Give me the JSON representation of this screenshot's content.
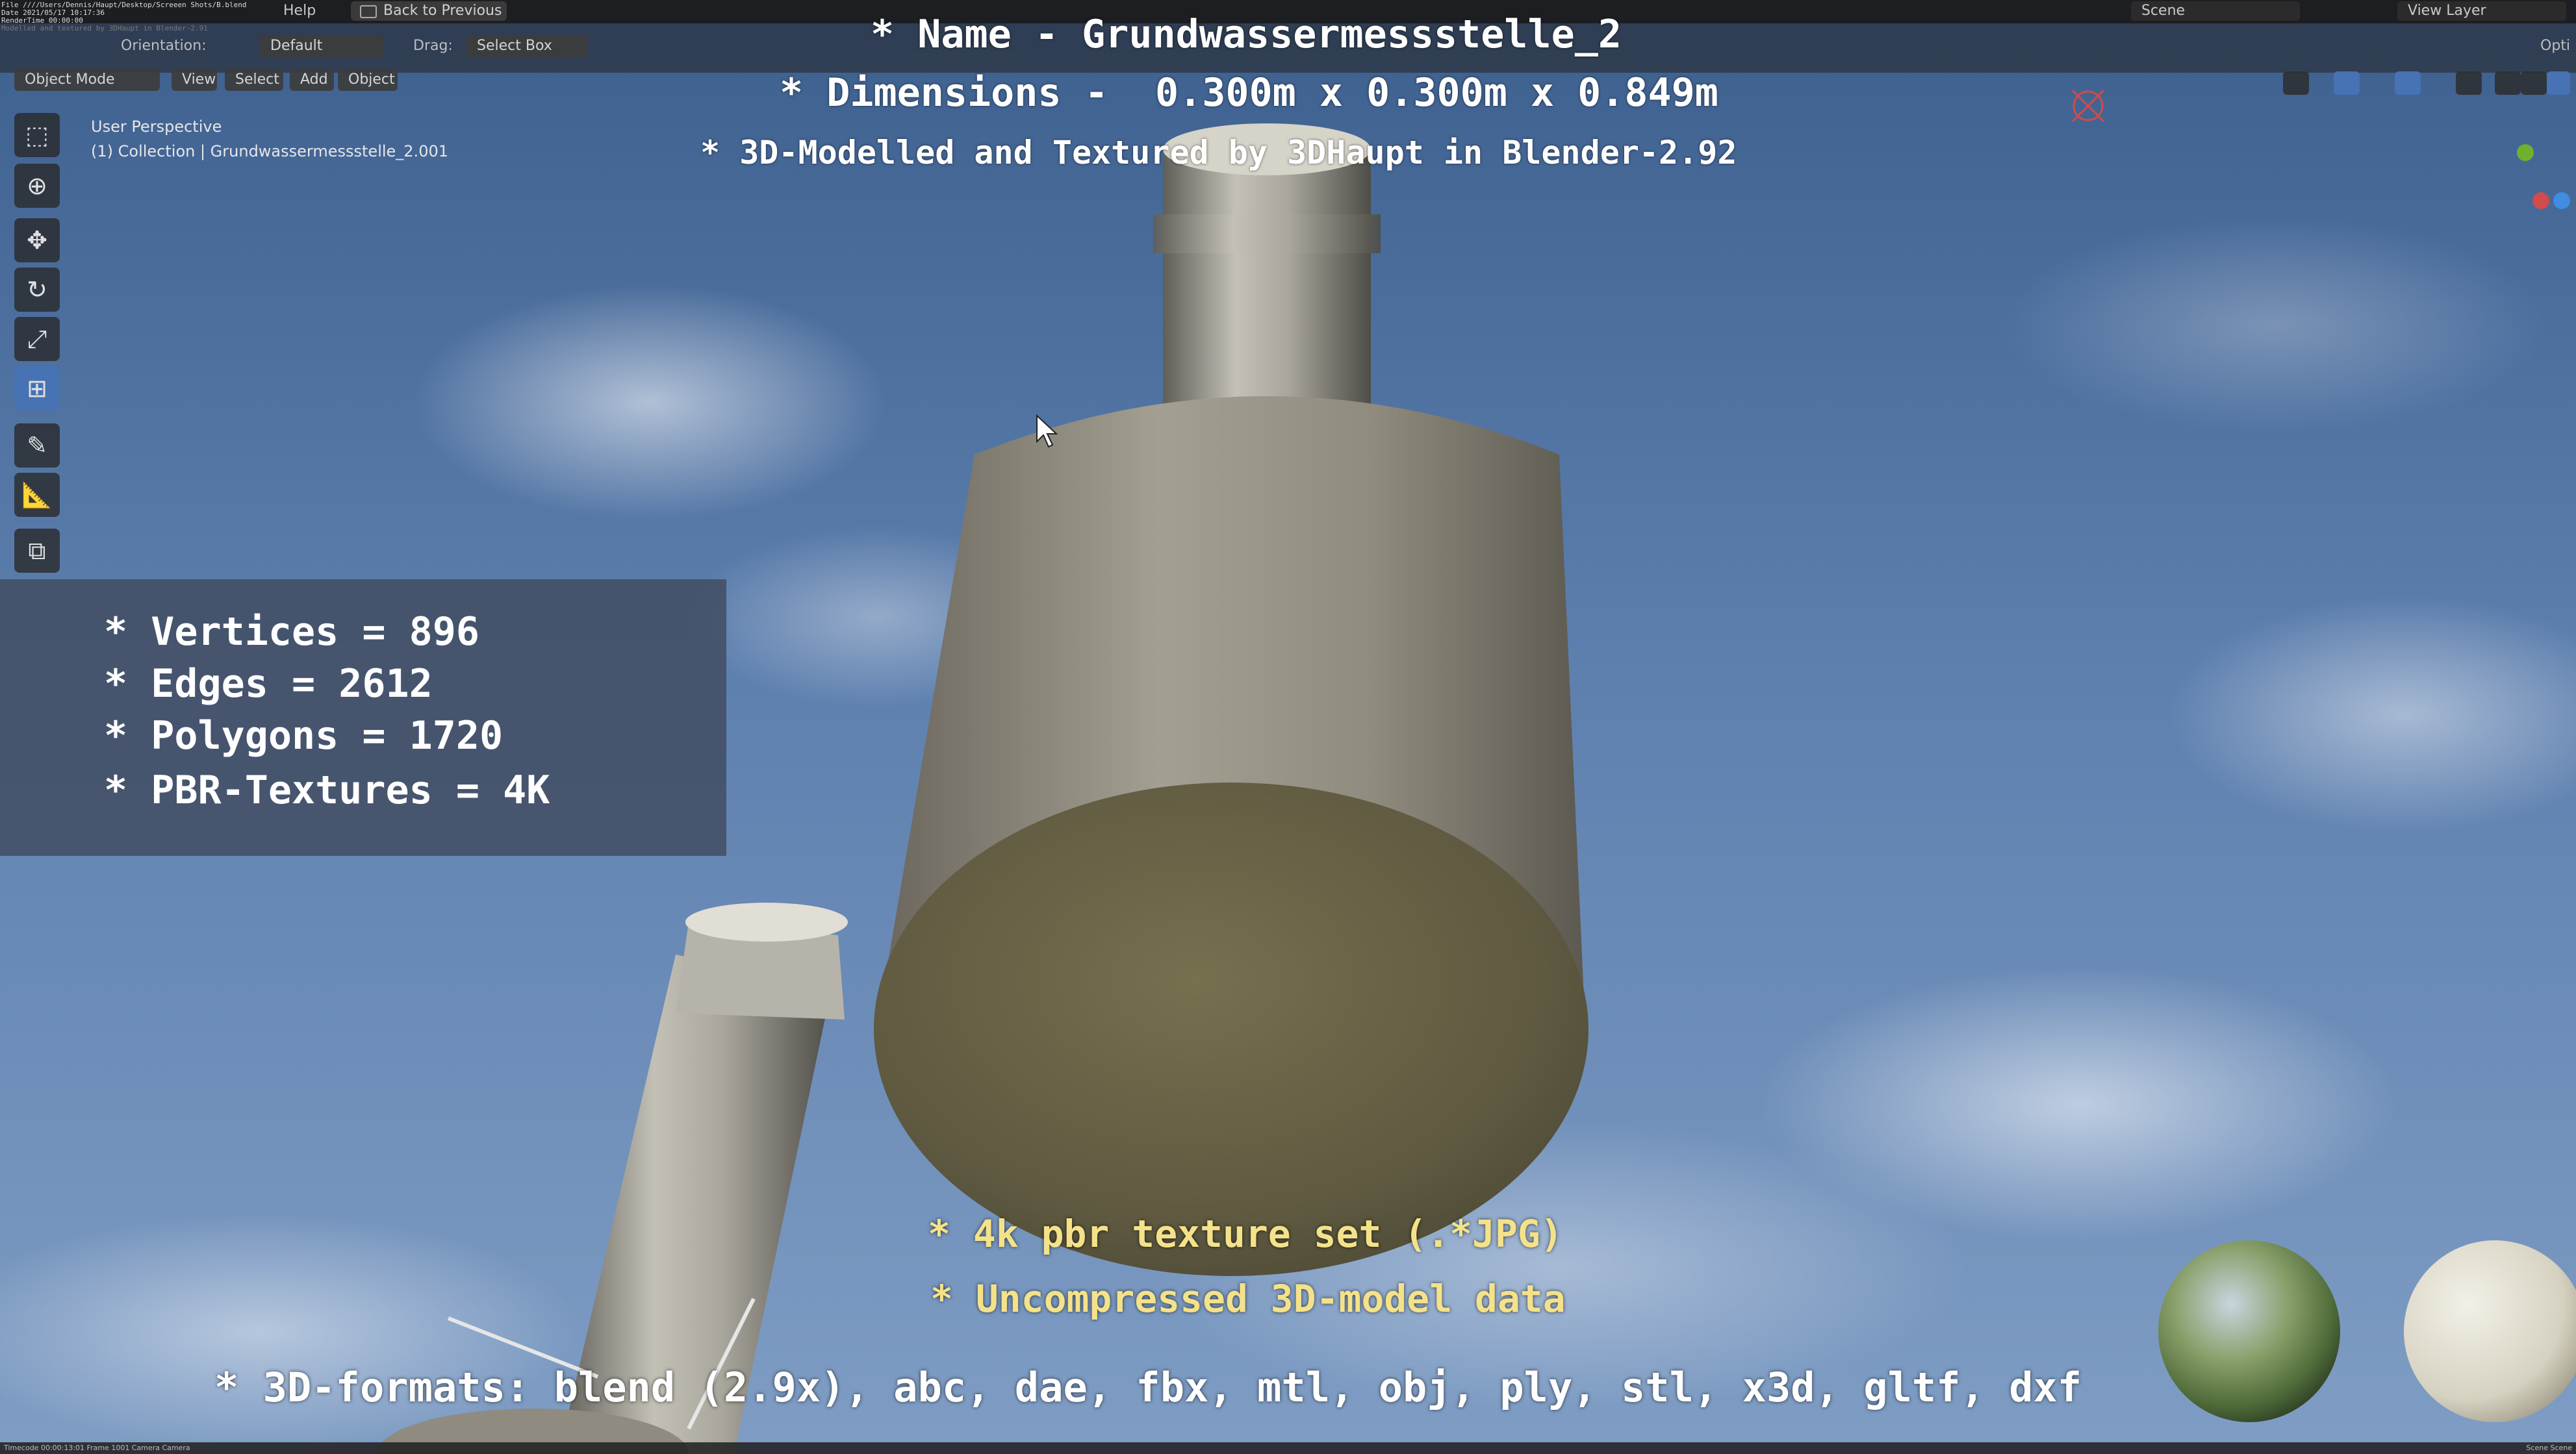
{
  "topbar": {
    "meta_lines": "File ////Users/Dennis/Haupt/Desktop/Screeen Shots/B.blend\nDate 2021/05/17 10:17:36\nRenderTime 00:00:00\nModelled and textured by 3DHaupt in Blender-2.91",
    "menu_help": "Help",
    "back_button": "Back to Previous",
    "scene_label": "Scene",
    "view_layer_label": "View Layer"
  },
  "toolheader": {
    "orientation_label": "Orientation:",
    "default_label": "Default",
    "drag_label": "Drag:",
    "select_box": "Select Box",
    "object_mode": "Object Mode",
    "menu_view": "View",
    "menu_select": "Select",
    "menu_add": "Add",
    "menu_object": "Object",
    "options": "Opti"
  },
  "viewport": {
    "perspective": "User Perspective",
    "collection": "(1) Collection | Grundwassermessstelle_2.001"
  },
  "overlay": {
    "name_line": "* Name - Grundwassermessstelle_2",
    "dimensions_line": "* Dimensions -  0.300m x 0.300m x 0.849m",
    "credit_line": "* 3D-Modelled and Textured by 3DHaupt in Blender-2.92"
  },
  "stats": {
    "vertices": "* Vertices = 896",
    "edges": "* Edges = 2612",
    "polygons": "* Polygons = 1720",
    "textures": "* PBR-Textures = 4K"
  },
  "bottom": {
    "texture_set": "* 4k pbr texture set (.*JPG)",
    "uncompressed": "* Uncompressed 3D-model data",
    "formats": "* 3D-formats: blend (2.9x), abc, dae, fbx, mtl, obj, ply, stl, x3d, gltf, dxf"
  },
  "statusbar": {
    "left": "Timecode 00:00:13:01   Frame 1001   Camera Camera",
    "right": "Scene Scene"
  },
  "icons": {
    "select": "select-box-icon",
    "cursor": "cursor-icon",
    "move": "move-icon",
    "rotate": "rotate-icon",
    "scale": "scale-icon",
    "transform": "transform-icon",
    "annotate": "annotate-icon",
    "measure": "measure-icon",
    "add_cube": "add-cube-icon"
  },
  "colors": {
    "active_tool": "#4772b3",
    "highlight_text": "#f4e28a"
  }
}
